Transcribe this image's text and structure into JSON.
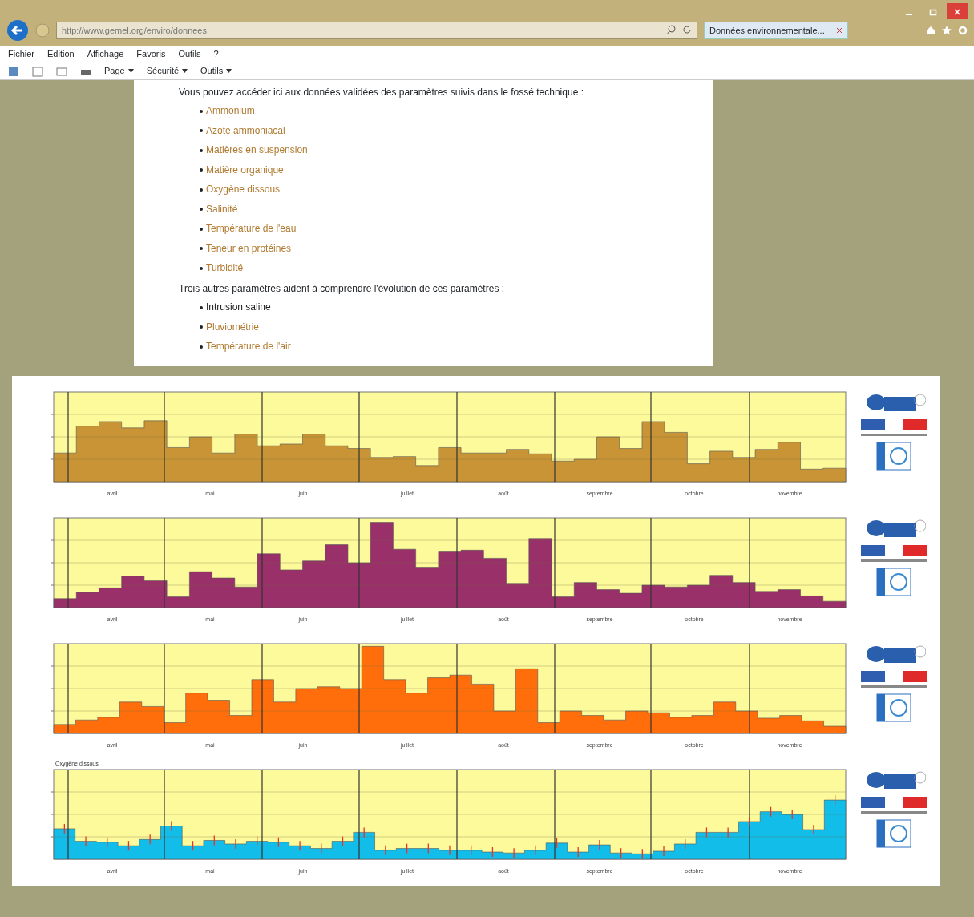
{
  "browser": {
    "address": "http://www.gemel.org/enviro/donnees",
    "tab_title": "Données environnementale...",
    "menu": [
      "Fichier",
      "Edition",
      "Affichage",
      "Favoris",
      "Outils",
      "?"
    ],
    "commands": [
      "Page",
      "Sécurité",
      "Outils"
    ]
  },
  "content": {
    "intro": "Vous pouvez accéder ici aux données validées des paramètres suivis dans le fossé technique :",
    "parameters": [
      {
        "label": "Ammonium",
        "link": true
      },
      {
        "label": "Azote ammoniacal",
        "link": true
      },
      {
        "label": "Matières en suspension",
        "link": true
      },
      {
        "label": "Matière organique",
        "link": true
      },
      {
        "label": "Oxygène dissous",
        "link": true
      },
      {
        "label": "Salinité",
        "link": true
      },
      {
        "label": "Température de l'eau",
        "link": true
      },
      {
        "label": "Teneur en protéines",
        "link": true
      },
      {
        "label": "Turbidité",
        "link": true
      }
    ],
    "intro2": "Trois autres paramètres aident à comprendre l'évolution de ces paramètres :",
    "other_parameters": [
      {
        "label": "Intrusion saline",
        "link": false
      },
      {
        "label": "Pluviométrie",
        "link": true
      },
      {
        "label": "Température de l'air",
        "link": true
      }
    ]
  },
  "charts": [
    {
      "color": "#c99436",
      "error_bars": false,
      "months": [
        "avril",
        "mai",
        "juin",
        "juillet",
        "août",
        "septembre",
        "octobre",
        "novembre"
      ]
    },
    {
      "color": "#99306a",
      "error_bars": false,
      "months": [
        "avril",
        "mai",
        "juin",
        "juillet",
        "août",
        "septembre",
        "octobre",
        "novembre"
      ]
    },
    {
      "color": "#ff6e0a",
      "error_bars": false,
      "months": [
        "avril",
        "mai",
        "juin",
        "juillet",
        "août",
        "septembre",
        "octobre",
        "novembre"
      ]
    },
    {
      "title": "Oxygène dissous",
      "color": "#13bde9",
      "error_bars": true,
      "months": [
        "avril",
        "mai",
        "juin",
        "juillet",
        "août",
        "septembre",
        "octobre",
        "novembre"
      ]
    }
  ]
}
